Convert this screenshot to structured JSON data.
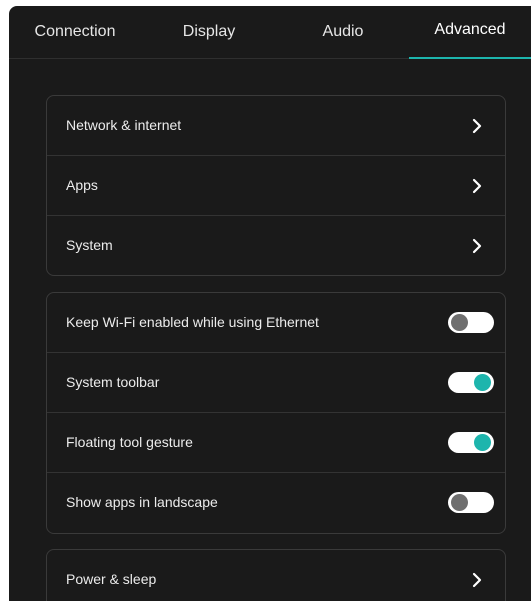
{
  "tabs": [
    {
      "label": "Connection"
    },
    {
      "label": "Display"
    },
    {
      "label": "Audio"
    },
    {
      "label": "Advanced",
      "active": true
    }
  ],
  "accent_color": "#1db5ad",
  "nav_group": {
    "items": [
      {
        "label": "Network & internet",
        "icon": "chevron-right-icon"
      },
      {
        "label": "Apps",
        "icon": "chevron-right-icon"
      },
      {
        "label": "System",
        "icon": "chevron-right-icon"
      }
    ]
  },
  "toggle_group": {
    "items": [
      {
        "label": "Keep Wi-Fi enabled while using Ethernet",
        "enabled": false
      },
      {
        "label": "System toolbar",
        "enabled": true
      },
      {
        "label": "Floating tool gesture",
        "enabled": true
      },
      {
        "label": "Show apps in landscape",
        "enabled": false
      }
    ]
  },
  "power_group": {
    "items": [
      {
        "label": "Power & sleep",
        "icon": "chevron-right-icon"
      }
    ]
  }
}
